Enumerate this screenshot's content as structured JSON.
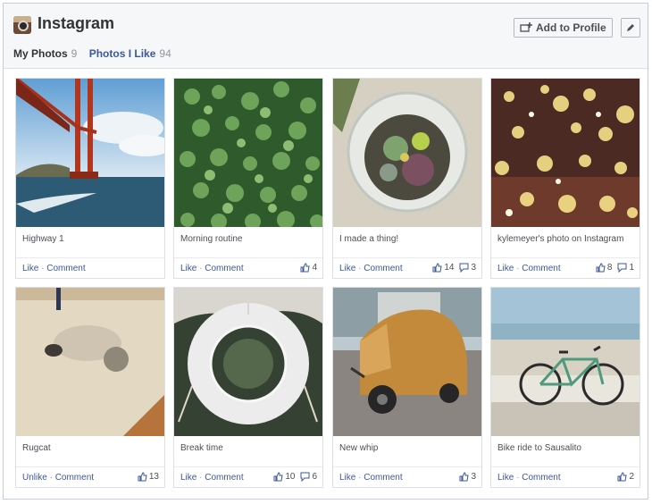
{
  "app": {
    "title": "Instagram"
  },
  "header": {
    "add_to_profile": "Add to Profile"
  },
  "tabs": [
    {
      "label": "My Photos",
      "count": "9"
    },
    {
      "label": "Photos I Like",
      "count": "94"
    }
  ],
  "photos": [
    {
      "caption": "Highway 1",
      "like_action": "Like",
      "comment_action": "Comment",
      "likes": "",
      "comments": "",
      "subject": "golden-gate-bridge"
    },
    {
      "caption": "Morning routine",
      "like_action": "Like",
      "comment_action": "Comment",
      "likes": "4",
      "comments": "",
      "subject": "clover-leaves"
    },
    {
      "caption": "I made a thing!",
      "like_action": "Like",
      "comment_action": "Comment",
      "likes": "14",
      "comments": "3",
      "subject": "terrarium"
    },
    {
      "caption": "kylemeyer's photo on Instagram",
      "like_action": "Like",
      "comment_action": "Comment",
      "likes": "8",
      "comments": "1",
      "subject": "bokeh-lights"
    },
    {
      "caption": "Rugcat",
      "like_action": "Unlike",
      "comment_action": "Comment",
      "likes": "13",
      "comments": "",
      "subject": "cat-on-rug"
    },
    {
      "caption": "Break time",
      "like_action": "Like",
      "comment_action": "Comment",
      "likes": "10",
      "comments": "6",
      "subject": "life-ring"
    },
    {
      "caption": "New whip",
      "like_action": "Like",
      "comment_action": "Comment",
      "likes": "3",
      "comments": "",
      "subject": "wooden-vehicle"
    },
    {
      "caption": "Bike ride to Sausalito",
      "like_action": "Like",
      "comment_action": "Comment",
      "likes": "2",
      "comments": "",
      "subject": "bicycle-beach"
    }
  ]
}
